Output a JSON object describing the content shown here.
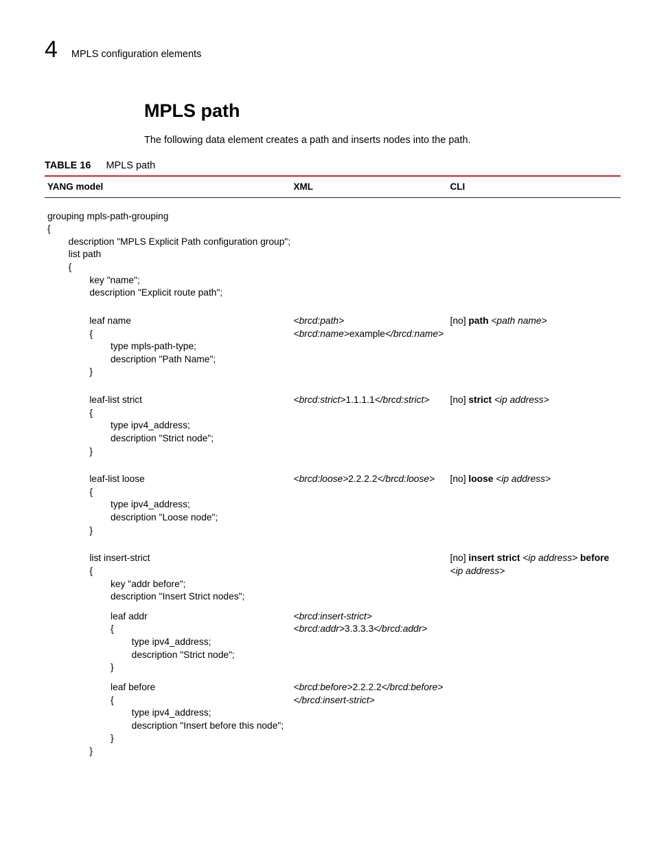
{
  "header": {
    "chapter_number": "4",
    "chapter_title": "MPLS configuration elements"
  },
  "section": {
    "title": "MPLS path",
    "intro": "The following data element creates a path and inserts nodes into the path."
  },
  "table": {
    "caption_number": "TABLE 16",
    "caption_title": "MPLS path",
    "cols": {
      "yang": "YANG model",
      "xml": "XML",
      "cli": "CLI"
    }
  },
  "yang": {
    "l01": "grouping mpls-path-grouping",
    "l02": "{",
    "l03": "        description \"MPLS Explicit Path configuration group\";",
    "l04": "        list path",
    "l05": "        {",
    "l06": "                key \"name\";",
    "l07": "                description \"Explicit route path\";",
    "l08": "                leaf name",
    "l09": "                {",
    "l10": "                        type mpls-path-type;",
    "l11": "                        description \"Path Name\";",
    "l12": "                }",
    "l13": "                leaf-list strict",
    "l14": "                {",
    "l15": "                        type ipv4_address;",
    "l16": "                        description \"Strict node\";",
    "l17": "                }",
    "l18": "                leaf-list loose",
    "l19": "                {",
    "l20": "                        type ipv4_address;",
    "l21": "                        description \"Loose node\";",
    "l22": "                }",
    "l23": "                list insert-strict",
    "l24": "                {",
    "l25": "                        key \"addr before\";",
    "l26": "                        description \"Insert Strict nodes\";",
    "l27": "                        leaf addr",
    "l28": "                        {",
    "l29": "                                type ipv4_address;",
    "l30": "                                description \"Strict node\";",
    "l31": "                        }",
    "l32": "                        leaf before",
    "l33": "                        {",
    "l34": "                                type ipv4_address;",
    "l35": "                                description \"Insert before this node\";",
    "l36": "                        }",
    "l37": "                }"
  },
  "xml": {
    "name_open": "<brcd:path>",
    "name_line": "<brcd:name>",
    "name_val": "example",
    "name_close": "</brcd:name>",
    "strict_open": "<brcd:strict>",
    "strict_val": "1.1.1.1",
    "strict_close": "</brcd:strict>",
    "loose_open": "<brcd:loose>",
    "loose_val": "2.2.2.2",
    "loose_close": "</brcd:loose>",
    "is_open": "<brcd:insert-strict>",
    "is_addr_open": "<brcd:addr>",
    "is_addr_val": "3.3.3.3",
    "is_addr_close": "</brcd:addr>",
    "is_before_open": "<brcd:before>",
    "is_before_val": "2.2.2.2",
    "is_before_close": "</brcd:before>",
    "is_close": "</brcd:insert-strict>"
  },
  "cli": {
    "no": "[no]",
    "path_kw": "path",
    "path_var": "<path name>",
    "strict_kw": "strict",
    "strict_var": "<ip address>",
    "loose_kw": "loose",
    "loose_var": "<ip address>",
    "insert_strict_kw": "insert strict",
    "before_kw": "before",
    "ipaddr_var": "<ip address>"
  }
}
